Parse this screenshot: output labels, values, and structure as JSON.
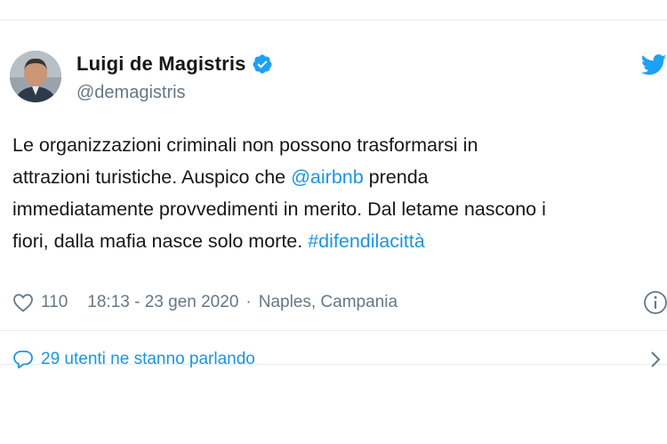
{
  "tweet": {
    "author_name": "Luigi de Magistris",
    "author_handle": "@demagistris",
    "verified": true,
    "text_lines": [
      [
        {
          "t": "Le organizzazioni criminali non possono trasformarsi in",
          "link": false
        }
      ],
      [
        {
          "t": "attrazioni turistiche. Auspico che ",
          "link": false
        },
        {
          "t": "@airbnb",
          "link": true
        },
        {
          "t": " prenda",
          "link": false
        }
      ],
      [
        {
          "t": "immediatamente provvedimenti in merito. Dal letame nascono i",
          "link": false
        }
      ],
      [
        {
          "t": "fiori, dalla mafia nasce solo morte. ",
          "link": false
        },
        {
          "t": "#difendilacittà",
          "link": true
        }
      ]
    ],
    "likes": "110",
    "time": "18:13 - 23 gen 2020",
    "separator": "·",
    "location": "Naples, Campania",
    "conversation_label": "29 utenti ne stanno parlando"
  },
  "icons": {
    "like": "heart-icon",
    "info": "info-icon",
    "comment": "comment-icon",
    "chevron": "chevron-right-icon",
    "brand": "twitter-bird-icon",
    "verified": "verified-badge-icon"
  },
  "colors": {
    "link": "#1b95e0",
    "text": "#14171a",
    "muted": "#657786",
    "twitter_blue": "#1da1f2",
    "border": "#e6ecf0"
  }
}
